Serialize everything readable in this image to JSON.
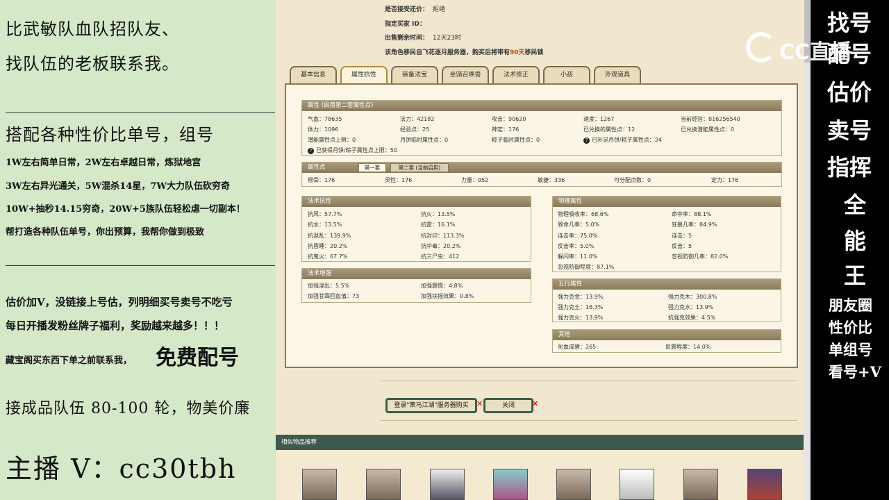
{
  "left_panel": {
    "line1": "比武敏队血队招队友、",
    "line2": "找队伍的老板联系我。",
    "line3": "搭配各种性价比单号，组号",
    "line4": "1W左右简单日常，2W左右卓越日常，炼狱地宫",
    "line5": "3W左右异光通关，5W混杀14星，7W大力队伍砍穷奇",
    "line6": "10W+抽秒14.15穷奇，20W+5族队伍轻松虐一切副本！",
    "line7": "帮打造各种队伍单号，你出预算，我帮你做到极致",
    "line8": "估价加V，没链接上号估，列明细买号卖号不吃亏",
    "line9": "每日开播发粉丝牌子福利，奖励越来越多！！！",
    "line10a": "藏宝阁买东西下单之前联系我，",
    "line10b": "免费配号",
    "line11": "接成品队伍 80-100 轮，物美价廉",
    "line12": "主播 V：cc30tbh"
  },
  "right_panel": {
    "vertical_big": [
      "找号",
      "配号",
      "估价",
      "卖号",
      "指挥",
      "全",
      "能",
      "王"
    ],
    "vertical_small": [
      "朋友圈",
      "性价比",
      "单组号",
      "看号+V"
    ]
  },
  "logo": {
    "text": "CC直播"
  },
  "info": {
    "bargain_label": "是否接受还价：",
    "bargain_value": "拒绝",
    "buyer_label": "指定买家 ID：",
    "time_label": "出售剩余时间：",
    "time_value": "12天23时",
    "migrate_a": "该角色移民自飞花逐月服务器，购买后将带有",
    "migrate_days": "90天",
    "migrate_b": "移民锁"
  },
  "tabs": [
    "基本信息",
    "属性抗性",
    "装备法宝",
    "坐骑召唤兽",
    "法术修正",
    "小孩",
    "外观道具"
  ],
  "attr": {
    "title": "属性 (启用第二套属性点)",
    "rows": [
      [
        "气血：78635",
        "法力：42182",
        "攻击：90620",
        "速度：1267",
        "当前经验：816256540"
      ],
      [
        "体力：1096",
        "经验点：25",
        "神定：176",
        "已兑换的属性点：12",
        "已兑换潜能属性点：0"
      ],
      [
        "潜能属性点上限：0",
        "月饼临时属性点：0",
        "粽子临时属性点：0",
        "已补足月饼/粽子属性点：24",
        ""
      ]
    ],
    "row4": "已获得月饼/粽子属性点上限：50"
  },
  "points": {
    "title": "属性点",
    "subtab1": "第一套",
    "subtab2": "第二套 (当前启用)",
    "row": [
      "根骨：176",
      "灵性：176",
      "力量：952",
      "敏捷：336",
      "可分配点数：0",
      "定力：176"
    ]
  },
  "resist": {
    "title": "法术抗性",
    "rows": [
      [
        "抗风：57.7%",
        "抗火：13.5%"
      ],
      [
        "抗水：13.5%",
        "抗雷：16.1%"
      ],
      [
        "抗混乱：139.9%",
        "抗封印：113.3%"
      ],
      [
        "抗昏睡：20.2%",
        "抗中毒：20.2%"
      ],
      [
        "抗鬼火：67.7%",
        "抗三尸虫：412"
      ]
    ]
  },
  "enhance": {
    "title": "法术增强",
    "rows": [
      [
        "加强混乱：5.5%",
        "加强震慑：4.8%"
      ],
      [
        "加强甘霖回血值：73",
        "加强扶摇效果：0.8%"
      ]
    ]
  },
  "physical": {
    "title": "物理属性",
    "rows": [
      [
        "物理吸收率：68.6%",
        "命中率：88.1%"
      ],
      [
        "致命几率：5.0%",
        "狂暴几率：84.9%"
      ],
      [
        "连击率：75.0%",
        "连击：5"
      ],
      [
        "反击率：5.0%",
        "反击：5"
      ],
      [
        "躲闪率：11.0%",
        "忽视防御几率：82.0%"
      ],
      [
        "忽视防御程度：87.1%",
        ""
      ]
    ]
  },
  "wuxing": {
    "title": "五行属性",
    "rows": [
      [
        "强力克金：13.9%",
        "强力克木：300.8%"
      ],
      [
        "强力克土：16.3%",
        "强力克水：13.9%"
      ],
      [
        "强力克火：13.9%",
        "抗强克效果：4.5%"
      ]
    ]
  },
  "other": {
    "title": "其他",
    "rows": [
      [
        "化血成碧：265",
        "反震程度：14.0%"
      ]
    ]
  },
  "buttons": {
    "login": "登录\"策马江湖\"服务器购买",
    "close": "关闭"
  },
  "recommend": {
    "title": "相似物品推荐"
  }
}
